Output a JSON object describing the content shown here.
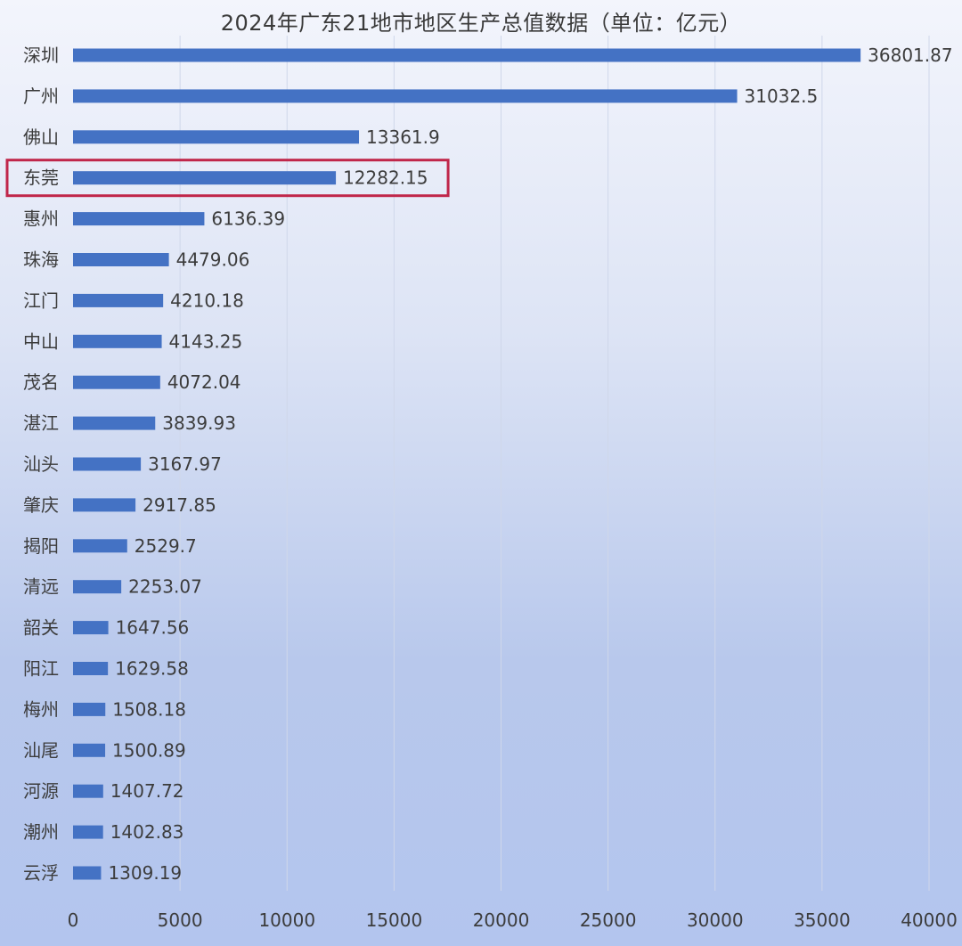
{
  "chart_data": {
    "type": "bar",
    "orientation": "horizontal",
    "title": "2024年广东21地市地区生产总值数据（单位：亿元）",
    "categories": [
      "深圳",
      "广州",
      "佛山",
      "东莞",
      "惠州",
      "珠海",
      "江门",
      "中山",
      "茂名",
      "湛江",
      "汕头",
      "肇庆",
      "揭阳",
      "清远",
      "韶关",
      "阳江",
      "梅州",
      "汕尾",
      "河源",
      "潮州",
      "云浮"
    ],
    "values": [
      36801.87,
      31032.5,
      13361.9,
      12282.15,
      6136.39,
      4479.06,
      4210.18,
      4143.25,
      4072.04,
      3839.93,
      3167.97,
      2917.85,
      2529.7,
      2253.07,
      1647.56,
      1629.58,
      1508.18,
      1500.89,
      1407.72,
      1402.83,
      1309.19
    ],
    "value_labels": [
      "36801.87",
      "31032.5",
      "13361.9",
      "12282.15",
      "6136.39",
      "4479.06",
      "4210.18",
      "4143.25",
      "4072.04",
      "3839.93",
      "3167.97",
      "2917.85",
      "2529.7",
      "2253.07",
      "1647.56",
      "1629.58",
      "1508.18",
      "1500.89",
      "1407.72",
      "1402.83",
      "1309.19"
    ],
    "xticks": [
      "0",
      "5000",
      "10000",
      "15000",
      "20000",
      "25000",
      "30000",
      "35000",
      "40000"
    ],
    "xlim": [
      0,
      40000
    ],
    "grid": true,
    "highlighted_category": "东莞",
    "colors": {
      "bar": "#4472c4",
      "highlight_box": "#c0264a",
      "grid": "#cfd7ea",
      "text": "#3c3c3c"
    }
  }
}
